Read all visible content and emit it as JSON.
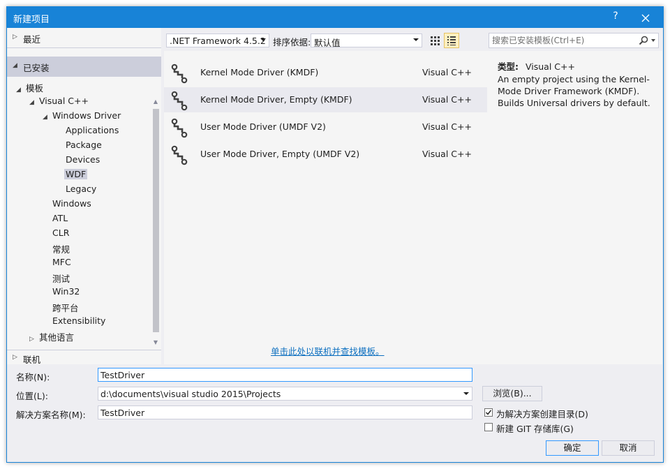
{
  "window": {
    "title": "新建项目",
    "help": "?"
  },
  "nav": {
    "recent": "最近",
    "installed": "已安装",
    "online": "联机"
  },
  "tree": {
    "templates": "模板",
    "visual_cpp": "Visual C++",
    "windows_driver": "Windows Driver",
    "applications": "Applications",
    "package": "Package",
    "devices": "Devices",
    "wdf": "WDF",
    "legacy": "Legacy",
    "windows": "Windows",
    "atl": "ATL",
    "clr": "CLR",
    "general": "常规",
    "mfc": "MFC",
    "test": "测试",
    "win32": "Win32",
    "cross_platform": "跨平台",
    "extensibility": "Extensibility",
    "other_languages": "其他语言"
  },
  "toolbar": {
    "framework": ".NET Framework 4.5.2",
    "sort_label": "排序依据:",
    "sort_value": "默认值"
  },
  "templates": [
    {
      "name": "Kernel Mode Driver (KMDF)",
      "lang": "Visual C++"
    },
    {
      "name": "Kernel Mode Driver, Empty (KMDF)",
      "lang": "Visual C++"
    },
    {
      "name": "User Mode Driver (UMDF V2)",
      "lang": "Visual C++"
    },
    {
      "name": "User Mode Driver, Empty (UMDF V2)",
      "lang": "Visual C++"
    }
  ],
  "online_link": "单击此处以联机并查找模板。",
  "search": {
    "placeholder": "搜索已安装模板(Ctrl+E)"
  },
  "details": {
    "type_label": "类型:",
    "type_value": "Visual C++",
    "description": "An empty project using the Kernel-Mode Driver Framework (KMDF). Builds Universal drivers by default."
  },
  "form": {
    "name_label": "名称(N):",
    "name_value": "TestDriver",
    "location_label": "位置(L):",
    "location_value": "d:\\documents\\visual studio 2015\\Projects",
    "solution_label": "解决方案名称(M):",
    "solution_value": "TestDriver",
    "browse": "浏览(B)...",
    "create_dir": "为解决方案创建目录(D)",
    "git_repo": "新建 GIT 存储库(G)",
    "ok": "确定",
    "cancel": "取消"
  },
  "state": {
    "create_dir_checked": true,
    "git_repo_checked": false
  },
  "colors": {
    "accent": "#1883d7",
    "link": "#0e70c0",
    "selected": "#cccedb"
  }
}
